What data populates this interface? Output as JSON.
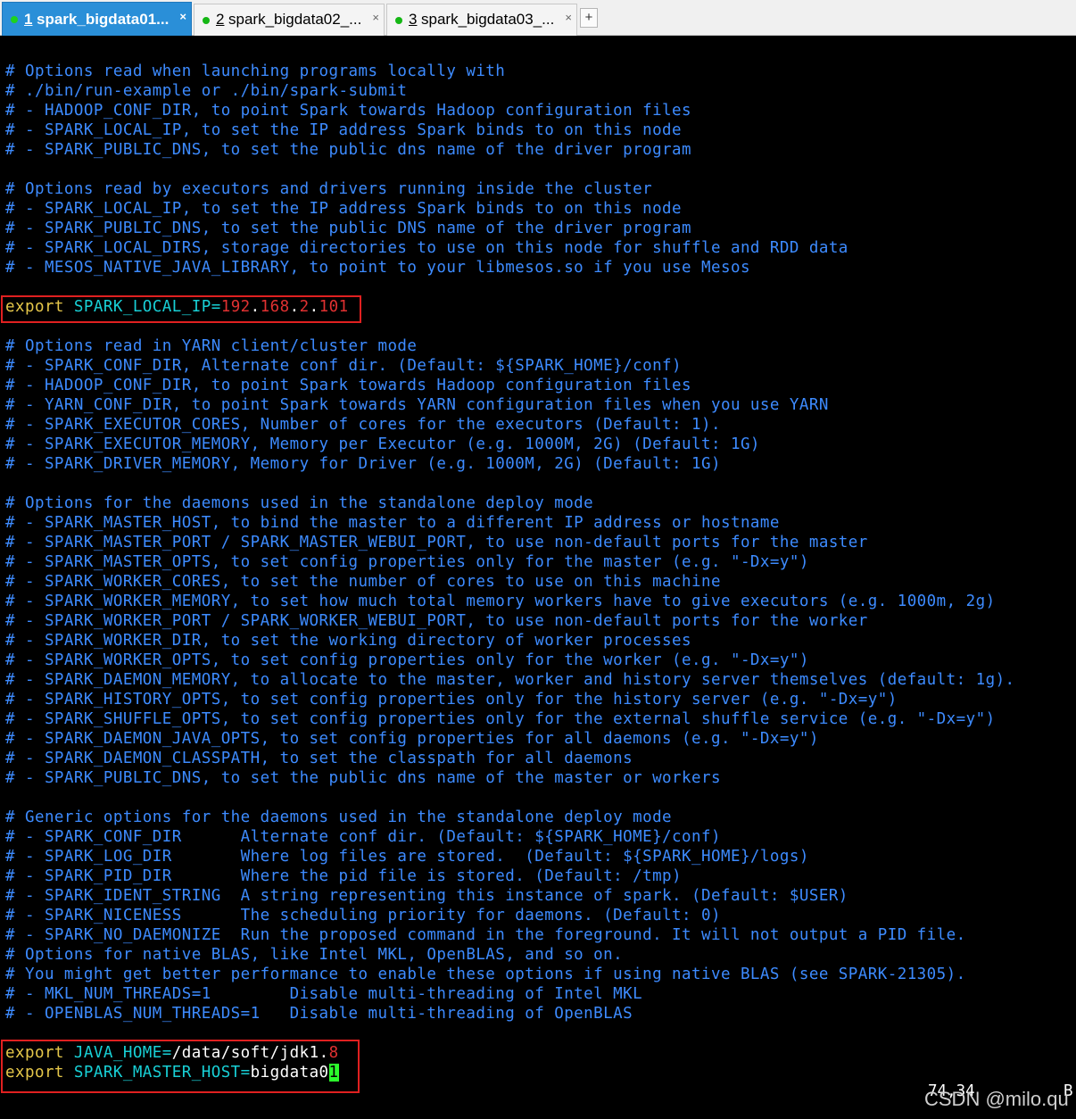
{
  "tabs": [
    {
      "num": "1",
      "label": " spark_bigdata01...",
      "active": true
    },
    {
      "num": "2",
      "label": " spark_bigdata02_...",
      "active": false
    },
    {
      "num": "3",
      "label": " spark_bigdata03_...",
      "active": false
    }
  ],
  "tab_close_glyph": "×",
  "new_tab_glyph": "+",
  "comments": {
    "c1": "# Options read when launching programs locally with",
    "c2": "# ./bin/run-example or ./bin/spark-submit",
    "c3": "# - HADOOP_CONF_DIR, to point Spark towards Hadoop configuration files",
    "c4": "# - SPARK_LOCAL_IP, to set the IP address Spark binds to on this node",
    "c5": "# - SPARK_PUBLIC_DNS, to set the public dns name of the driver program",
    "c6": "# Options read by executors and drivers running inside the cluster",
    "c7": "# - SPARK_LOCAL_IP, to set the IP address Spark binds to on this node",
    "c8": "# - SPARK_PUBLIC_DNS, to set the public DNS name of the driver program",
    "c9": "# - SPARK_LOCAL_DIRS, storage directories to use on this node for shuffle and RDD data",
    "c10": "# - MESOS_NATIVE_JAVA_LIBRARY, to point to your libmesos.so if you use Mesos",
    "c11": "# Options read in YARN client/cluster mode",
    "c12": "# - SPARK_CONF_DIR, Alternate conf dir. (Default: ${SPARK_HOME}/conf)",
    "c13": "# - HADOOP_CONF_DIR, to point Spark towards Hadoop configuration files",
    "c14": "# - YARN_CONF_DIR, to point Spark towards YARN configuration files when you use YARN",
    "c15": "# - SPARK_EXECUTOR_CORES, Number of cores for the executors (Default: 1).",
    "c16": "# - SPARK_EXECUTOR_MEMORY, Memory per Executor (e.g. 1000M, 2G) (Default: 1G)",
    "c17": "# - SPARK_DRIVER_MEMORY, Memory for Driver (e.g. 1000M, 2G) (Default: 1G)",
    "c18": "# Options for the daemons used in the standalone deploy mode",
    "c19": "# - SPARK_MASTER_HOST, to bind the master to a different IP address or hostname",
    "c20": "# - SPARK_MASTER_PORT / SPARK_MASTER_WEBUI_PORT, to use non-default ports for the master",
    "c21": "# - SPARK_MASTER_OPTS, to set config properties only for the master (e.g. \"-Dx=y\")",
    "c22": "# - SPARK_WORKER_CORES, to set the number of cores to use on this machine",
    "c23": "# - SPARK_WORKER_MEMORY, to set how much total memory workers have to give executors (e.g. 1000m, 2g)",
    "c24": "# - SPARK_WORKER_PORT / SPARK_WORKER_WEBUI_PORT, to use non-default ports for the worker",
    "c25": "# - SPARK_WORKER_DIR, to set the working directory of worker processes",
    "c26": "# - SPARK_WORKER_OPTS, to set config properties only for the worker (e.g. \"-Dx=y\")",
    "c27": "# - SPARK_DAEMON_MEMORY, to allocate to the master, worker and history server themselves (default: 1g).",
    "c28": "# - SPARK_HISTORY_OPTS, to set config properties only for the history server (e.g. \"-Dx=y\")",
    "c29": "# - SPARK_SHUFFLE_OPTS, to set config properties only for the external shuffle service (e.g. \"-Dx=y\")",
    "c30": "# - SPARK_DAEMON_JAVA_OPTS, to set config properties for all daemons (e.g. \"-Dx=y\")",
    "c31": "# - SPARK_DAEMON_CLASSPATH, to set the classpath for all daemons",
    "c32": "# - SPARK_PUBLIC_DNS, to set the public dns name of the master or workers",
    "c33": "# Generic options for the daemons used in the standalone deploy mode",
    "c34": "# - SPARK_CONF_DIR      Alternate conf dir. (Default: ${SPARK_HOME}/conf)",
    "c35": "# - SPARK_LOG_DIR       Where log files are stored.  (Default: ${SPARK_HOME}/logs)",
    "c36": "# - SPARK_PID_DIR       Where the pid file is stored. (Default: /tmp)",
    "c37": "# - SPARK_IDENT_STRING  A string representing this instance of spark. (Default: $USER)",
    "c38": "# - SPARK_NICENESS      The scheduling priority for daemons. (Default: 0)",
    "c39": "# - SPARK_NO_DAEMONIZE  Run the proposed command in the foreground. It will not output a PID file.",
    "c40": "# Options for native BLAS, like Intel MKL, OpenBLAS, and so on.",
    "c41": "# You might get better performance to enable these options if using native BLAS (see SPARK-21305).",
    "c42": "# - MKL_NUM_THREADS=1        Disable multi-threading of Intel MKL",
    "c43": "# - OPENBLAS_NUM_THREADS=1   Disable multi-threading of OpenBLAS"
  },
  "export_ip": {
    "kw": "export",
    "var": " SPARK_LOCAL_IP=",
    "o1": "192",
    "d1": ".",
    "o2": "168",
    "d2": ".",
    "o3": "2",
    "d3": ".",
    "o4": "101"
  },
  "export_java": {
    "kw": "export",
    "var": " JAVA_HOME=",
    "path": "/data/soft/jdk1.",
    "ver": "8"
  },
  "export_master": {
    "kw": "export",
    "var": " SPARK_MASTER_HOST=",
    "host": "bigdata0",
    "cursor_char": "1"
  },
  "status": {
    "position": "74,34",
    "scroll": "B"
  },
  "watermark": "CSDN @milo.qu",
  "colors": {
    "comment": "#3d8bff",
    "keyword": "#e6c84a",
    "variable": "#18d0d6",
    "number": "#e03131",
    "active_tab": "#2a8fd8",
    "highlight_box": "#e02020",
    "cursor": "#2cff2c"
  }
}
